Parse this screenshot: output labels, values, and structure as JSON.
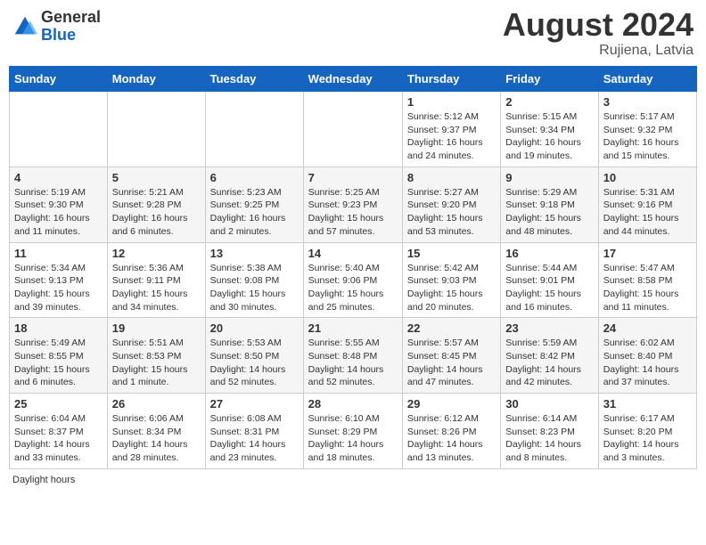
{
  "header": {
    "logo_general": "General",
    "logo_blue": "Blue",
    "month_year": "August 2024",
    "location": "Rujiena, Latvia"
  },
  "days_of_week": [
    "Sunday",
    "Monday",
    "Tuesday",
    "Wednesday",
    "Thursday",
    "Friday",
    "Saturday"
  ],
  "footer": {
    "daylight_label": "Daylight hours"
  },
  "weeks": [
    [
      {
        "day": "",
        "info": ""
      },
      {
        "day": "",
        "info": ""
      },
      {
        "day": "",
        "info": ""
      },
      {
        "day": "",
        "info": ""
      },
      {
        "day": "1",
        "info": "Sunrise: 5:12 AM\nSunset: 9:37 PM\nDaylight: 16 hours and 24 minutes."
      },
      {
        "day": "2",
        "info": "Sunrise: 5:15 AM\nSunset: 9:34 PM\nDaylight: 16 hours and 19 minutes."
      },
      {
        "day": "3",
        "info": "Sunrise: 5:17 AM\nSunset: 9:32 PM\nDaylight: 16 hours and 15 minutes."
      }
    ],
    [
      {
        "day": "4",
        "info": "Sunrise: 5:19 AM\nSunset: 9:30 PM\nDaylight: 16 hours and 11 minutes."
      },
      {
        "day": "5",
        "info": "Sunrise: 5:21 AM\nSunset: 9:28 PM\nDaylight: 16 hours and 6 minutes."
      },
      {
        "day": "6",
        "info": "Sunrise: 5:23 AM\nSunset: 9:25 PM\nDaylight: 16 hours and 2 minutes."
      },
      {
        "day": "7",
        "info": "Sunrise: 5:25 AM\nSunset: 9:23 PM\nDaylight: 15 hours and 57 minutes."
      },
      {
        "day": "8",
        "info": "Sunrise: 5:27 AM\nSunset: 9:20 PM\nDaylight: 15 hours and 53 minutes."
      },
      {
        "day": "9",
        "info": "Sunrise: 5:29 AM\nSunset: 9:18 PM\nDaylight: 15 hours and 48 minutes."
      },
      {
        "day": "10",
        "info": "Sunrise: 5:31 AM\nSunset: 9:16 PM\nDaylight: 15 hours and 44 minutes."
      }
    ],
    [
      {
        "day": "11",
        "info": "Sunrise: 5:34 AM\nSunset: 9:13 PM\nDaylight: 15 hours and 39 minutes."
      },
      {
        "day": "12",
        "info": "Sunrise: 5:36 AM\nSunset: 9:11 PM\nDaylight: 15 hours and 34 minutes."
      },
      {
        "day": "13",
        "info": "Sunrise: 5:38 AM\nSunset: 9:08 PM\nDaylight: 15 hours and 30 minutes."
      },
      {
        "day": "14",
        "info": "Sunrise: 5:40 AM\nSunset: 9:06 PM\nDaylight: 15 hours and 25 minutes."
      },
      {
        "day": "15",
        "info": "Sunrise: 5:42 AM\nSunset: 9:03 PM\nDaylight: 15 hours and 20 minutes."
      },
      {
        "day": "16",
        "info": "Sunrise: 5:44 AM\nSunset: 9:01 PM\nDaylight: 15 hours and 16 minutes."
      },
      {
        "day": "17",
        "info": "Sunrise: 5:47 AM\nSunset: 8:58 PM\nDaylight: 15 hours and 11 minutes."
      }
    ],
    [
      {
        "day": "18",
        "info": "Sunrise: 5:49 AM\nSunset: 8:55 PM\nDaylight: 15 hours and 6 minutes."
      },
      {
        "day": "19",
        "info": "Sunrise: 5:51 AM\nSunset: 8:53 PM\nDaylight: 15 hours and 1 minute."
      },
      {
        "day": "20",
        "info": "Sunrise: 5:53 AM\nSunset: 8:50 PM\nDaylight: 14 hours and 52 minutes."
      },
      {
        "day": "21",
        "info": "Sunrise: 5:55 AM\nSunset: 8:48 PM\nDaylight: 14 hours and 52 minutes."
      },
      {
        "day": "22",
        "info": "Sunrise: 5:57 AM\nSunset: 8:45 PM\nDaylight: 14 hours and 47 minutes."
      },
      {
        "day": "23",
        "info": "Sunrise: 5:59 AM\nSunset: 8:42 PM\nDaylight: 14 hours and 42 minutes."
      },
      {
        "day": "24",
        "info": "Sunrise: 6:02 AM\nSunset: 8:40 PM\nDaylight: 14 hours and 37 minutes."
      }
    ],
    [
      {
        "day": "25",
        "info": "Sunrise: 6:04 AM\nSunset: 8:37 PM\nDaylight: 14 hours and 33 minutes."
      },
      {
        "day": "26",
        "info": "Sunrise: 6:06 AM\nSunset: 8:34 PM\nDaylight: 14 hours and 28 minutes."
      },
      {
        "day": "27",
        "info": "Sunrise: 6:08 AM\nSunset: 8:31 PM\nDaylight: 14 hours and 23 minutes."
      },
      {
        "day": "28",
        "info": "Sunrise: 6:10 AM\nSunset: 8:29 PM\nDaylight: 14 hours and 18 minutes."
      },
      {
        "day": "29",
        "info": "Sunrise: 6:12 AM\nSunset: 8:26 PM\nDaylight: 14 hours and 13 minutes."
      },
      {
        "day": "30",
        "info": "Sunrise: 6:14 AM\nSunset: 8:23 PM\nDaylight: 14 hours and 8 minutes."
      },
      {
        "day": "31",
        "info": "Sunrise: 6:17 AM\nSunset: 8:20 PM\nDaylight: 14 hours and 3 minutes."
      }
    ]
  ]
}
